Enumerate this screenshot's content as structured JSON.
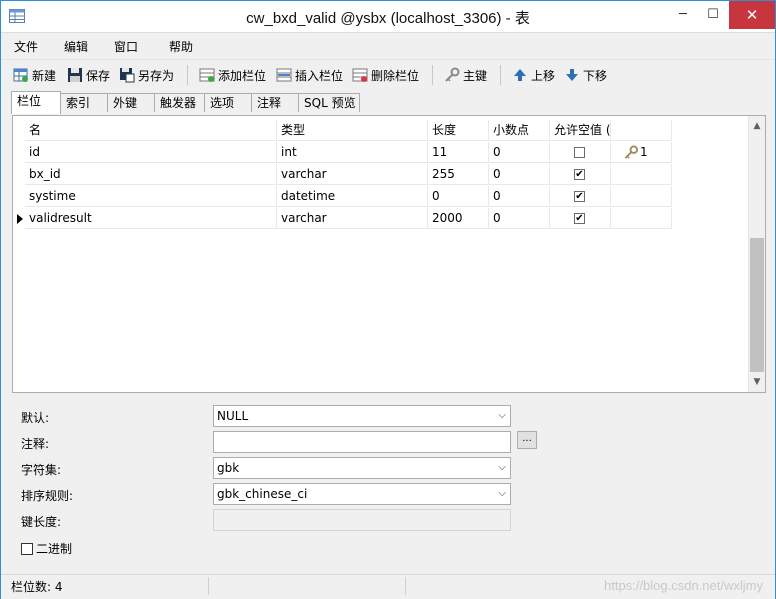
{
  "window": {
    "title": "cw_bxd_valid @ysbx (localhost_3306) - 表",
    "minimize": "─",
    "maximize": "☐",
    "close": "✕"
  },
  "menu": [
    "文件",
    "编辑",
    "窗口",
    "帮助"
  ],
  "toolbar": {
    "new": "新建",
    "save": "保存",
    "save_as": "另存为",
    "add_field": "添加栏位",
    "insert_field": "插入栏位",
    "delete_field": "删除栏位",
    "primary_key": "主键",
    "move_up": "上移",
    "move_down": "下移"
  },
  "tabs": [
    "栏位",
    "索引",
    "外键",
    "触发器",
    "选项",
    "注释",
    "SQL 预览"
  ],
  "grid": {
    "headers": [
      "名",
      "类型",
      "长度",
      "小数点",
      "允许空值 (",
      ""
    ],
    "rows": [
      {
        "name": "id",
        "type": "int",
        "length": "11",
        "decimals": "0",
        "allow_null": false,
        "key": "1"
      },
      {
        "name": "bx_id",
        "type": "varchar",
        "length": "255",
        "decimals": "0",
        "allow_null": true,
        "key": ""
      },
      {
        "name": "systime",
        "type": "datetime",
        "length": "0",
        "decimals": "0",
        "allow_null": true,
        "key": ""
      },
      {
        "name": "validresult",
        "type": "varchar",
        "length": "2000",
        "decimals": "0",
        "allow_null": true,
        "key": ""
      }
    ]
  },
  "properties": {
    "default_label": "默认:",
    "default_value": "NULL",
    "comment_label": "注释:",
    "comment_value": "",
    "comment_button": "...",
    "charset_label": "字符集:",
    "charset_value": "gbk",
    "collation_label": "排序规则:",
    "collation_value": "gbk_chinese_ci",
    "key_length_label": "键长度:",
    "binary_label": "二进制",
    "binary_checked": false
  },
  "status": {
    "field_count": "栏位数: 4",
    "watermark": "https://blog.csdn.net/wxljmy"
  }
}
